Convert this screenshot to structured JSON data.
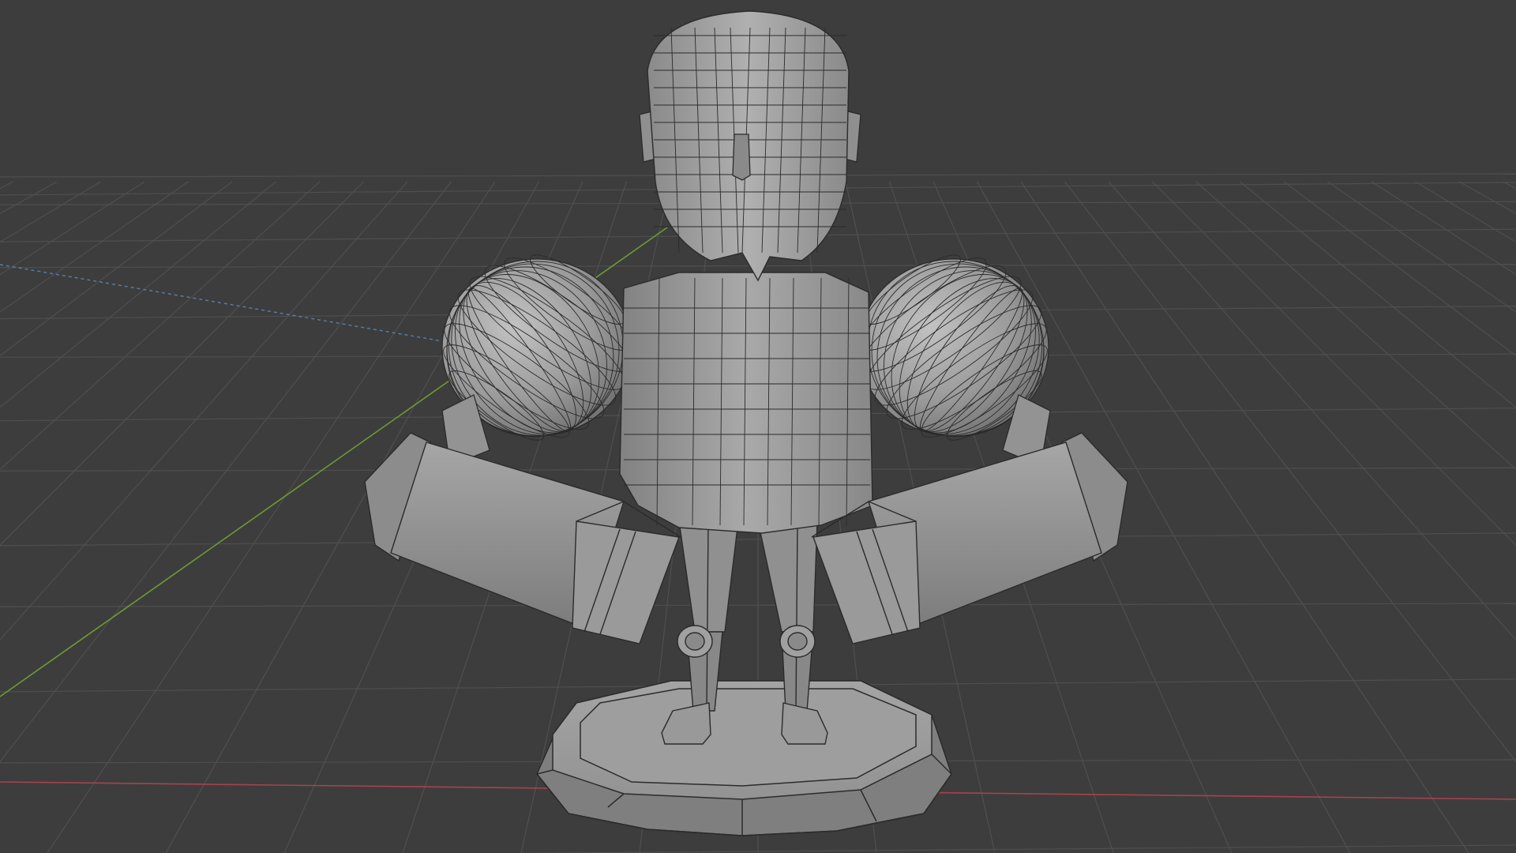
{
  "app": {
    "name": "3D Viewport",
    "shading": "solid-wireframe"
  },
  "viewport": {
    "background": "#3d3d3d",
    "grid_color": "#4f4f4f",
    "x_axis_color": "#a8424f",
    "y_axis_color": "#6e9a35",
    "z_axis_color": "#5a7fa8",
    "mesh_color": "#9c9c9c",
    "wire_color": "#2b2b2b"
  },
  "scene": {
    "object": "character-figure-on-pedestal",
    "parts": [
      "head",
      "ears",
      "nose",
      "torso",
      "shoulder-spheres",
      "upper-arms",
      "forearm-boxes",
      "legs",
      "knee-joints",
      "boots",
      "pedestal"
    ]
  }
}
